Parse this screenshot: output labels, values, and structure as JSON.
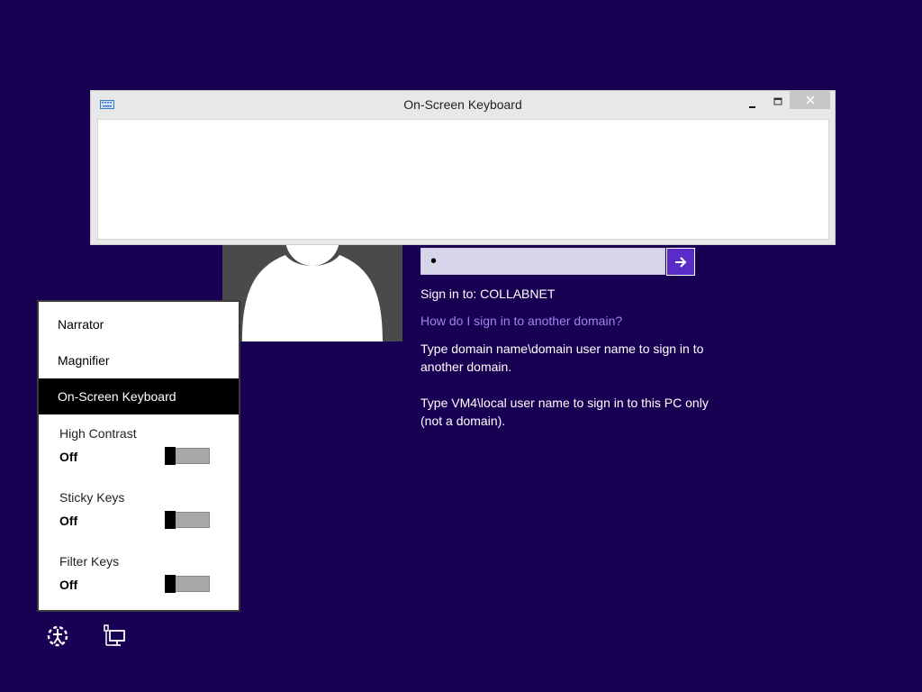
{
  "osk_window": {
    "title": "On-Screen Keyboard",
    "minimize_glyph": "–",
    "maximize_glyph": "□",
    "close_glyph": "✕"
  },
  "login": {
    "password_value": "•",
    "submit_icon": "arrow-right-icon",
    "sign_in_to": "Sign in to: COLLABNET",
    "other_domain_link": "How do I sign in to another domain?",
    "hint_domain": "Type domain name\\domain user name to sign in to another domain.",
    "hint_local": "Type VM4\\local user name to sign in to this PC only (not a domain)."
  },
  "ease_of_access_menu": {
    "items": [
      {
        "label": "Narrator",
        "selected": false
      },
      {
        "label": "Magnifier",
        "selected": false
      },
      {
        "label": "On-Screen Keyboard",
        "selected": true
      }
    ],
    "toggles": [
      {
        "label": "High Contrast",
        "state": "Off"
      },
      {
        "label": "Sticky Keys",
        "state": "Off"
      },
      {
        "label": "Filter Keys",
        "state": "Off"
      }
    ]
  },
  "bottom_icons": [
    "ease-of-access-icon",
    "network-icon"
  ],
  "colors": {
    "background": "#180052",
    "accent": "#5a2bc8",
    "link": "#9a86f0"
  }
}
